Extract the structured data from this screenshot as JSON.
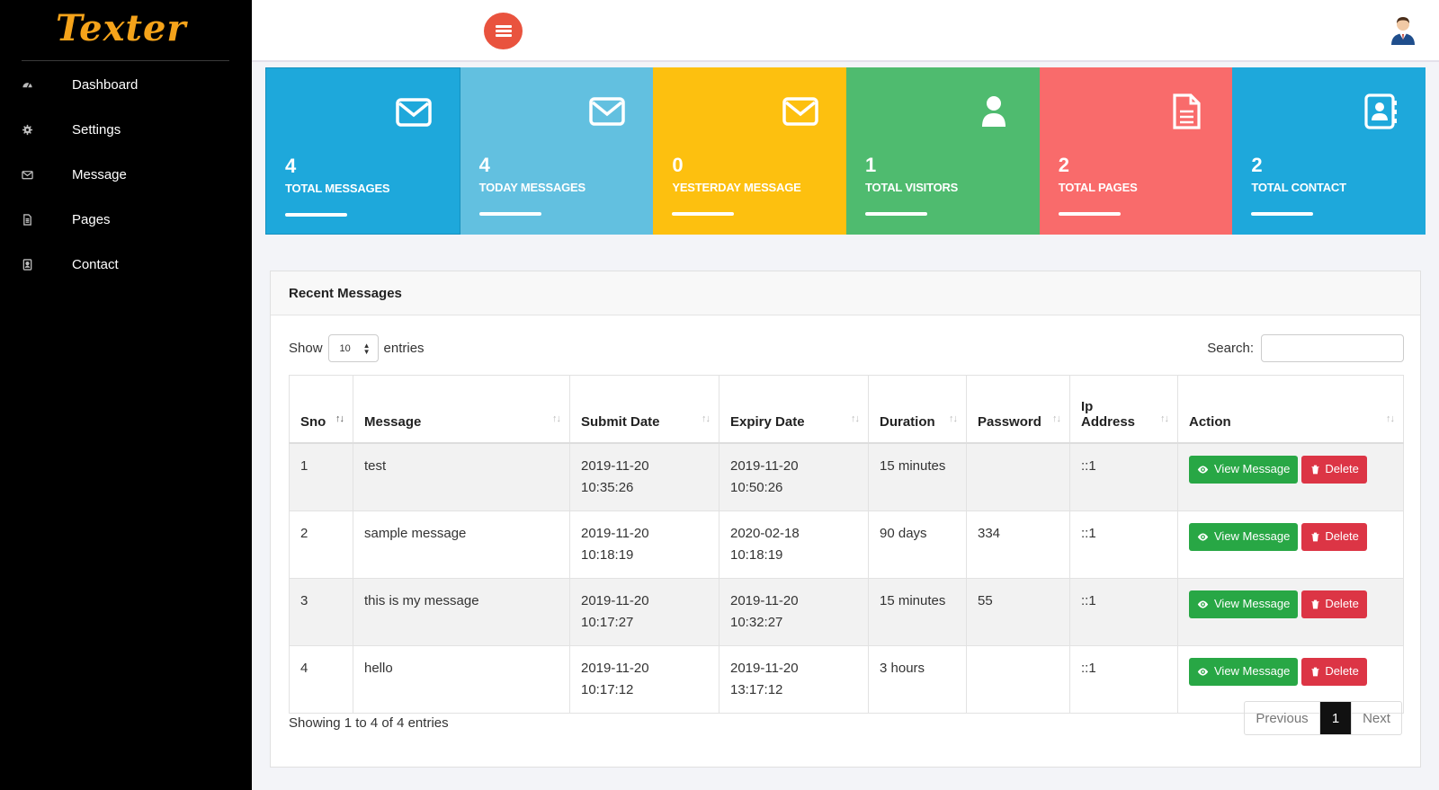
{
  "brand": "Texter",
  "sidebar": {
    "items": [
      {
        "label": "Dashboard",
        "icon": "dashboard-icon"
      },
      {
        "label": "Settings",
        "icon": "gear-icon"
      },
      {
        "label": "Message",
        "icon": "envelope-icon"
      },
      {
        "label": "Pages",
        "icon": "document-icon"
      },
      {
        "label": "Contact",
        "icon": "contact-icon"
      }
    ]
  },
  "cards": [
    {
      "value": "4",
      "label": "TOTAL MESSAGES",
      "icon": "envelope-icon",
      "color": "#1ea8db"
    },
    {
      "value": "4",
      "label": "TODAY MESSAGES",
      "icon": "envelope-icon",
      "color": "#62c0e0"
    },
    {
      "value": "0",
      "label": "YESTERDAY MESSAGE",
      "icon": "envelope-icon",
      "color": "#fdc00f"
    },
    {
      "value": "1",
      "label": "TOTAL VISITORS",
      "icon": "user-icon",
      "color": "#4fbb6f"
    },
    {
      "value": "2",
      "label": "TOTAL PAGES",
      "icon": "document-icon",
      "color": "#f96b6b"
    },
    {
      "value": "2",
      "label": "TOTAL CONTACT",
      "icon": "contact-book-icon",
      "color": "#1ea8db"
    }
  ],
  "recent": {
    "title": "Recent Messages",
    "show_label": "Show",
    "entries_label": "entries",
    "page_size": "10",
    "search_label": "Search:",
    "columns": [
      "Sno",
      "Message",
      "Submit Date",
      "Expiry Date",
      "Duration",
      "Password",
      "Ip Address",
      "Action"
    ],
    "rows": [
      {
        "sno": "1",
        "message": "test",
        "submit_date": "2019-11-20",
        "submit_time": "10:35:26",
        "expiry_date": "2019-11-20",
        "expiry_time": "10:50:26",
        "duration": "15 minutes",
        "password": "",
        "ip": "::1"
      },
      {
        "sno": "2",
        "message": "sample message",
        "submit_date": "2019-11-20",
        "submit_time": "10:18:19",
        "expiry_date": "2020-02-18",
        "expiry_time": "10:18:19",
        "duration": "90 days",
        "password": "334",
        "ip": "::1"
      },
      {
        "sno": "3",
        "message": "this is my message",
        "submit_date": "2019-11-20",
        "submit_time": "10:17:27",
        "expiry_date": "2019-11-20",
        "expiry_time": "10:32:27",
        "duration": "15 minutes",
        "password": "55",
        "ip": "::1"
      },
      {
        "sno": "4",
        "message": "hello",
        "submit_date": "2019-11-20",
        "submit_time": "10:17:12",
        "expiry_date": "2019-11-20",
        "expiry_time": "13:17:12",
        "duration": "3 hours",
        "password": "",
        "ip": "::1"
      }
    ],
    "view_label": "View Message",
    "delete_label": "Delete",
    "info": "Showing 1 to 4 of 4 entries",
    "pagination": {
      "previous": "Previous",
      "current": "1",
      "next": "Next"
    }
  }
}
